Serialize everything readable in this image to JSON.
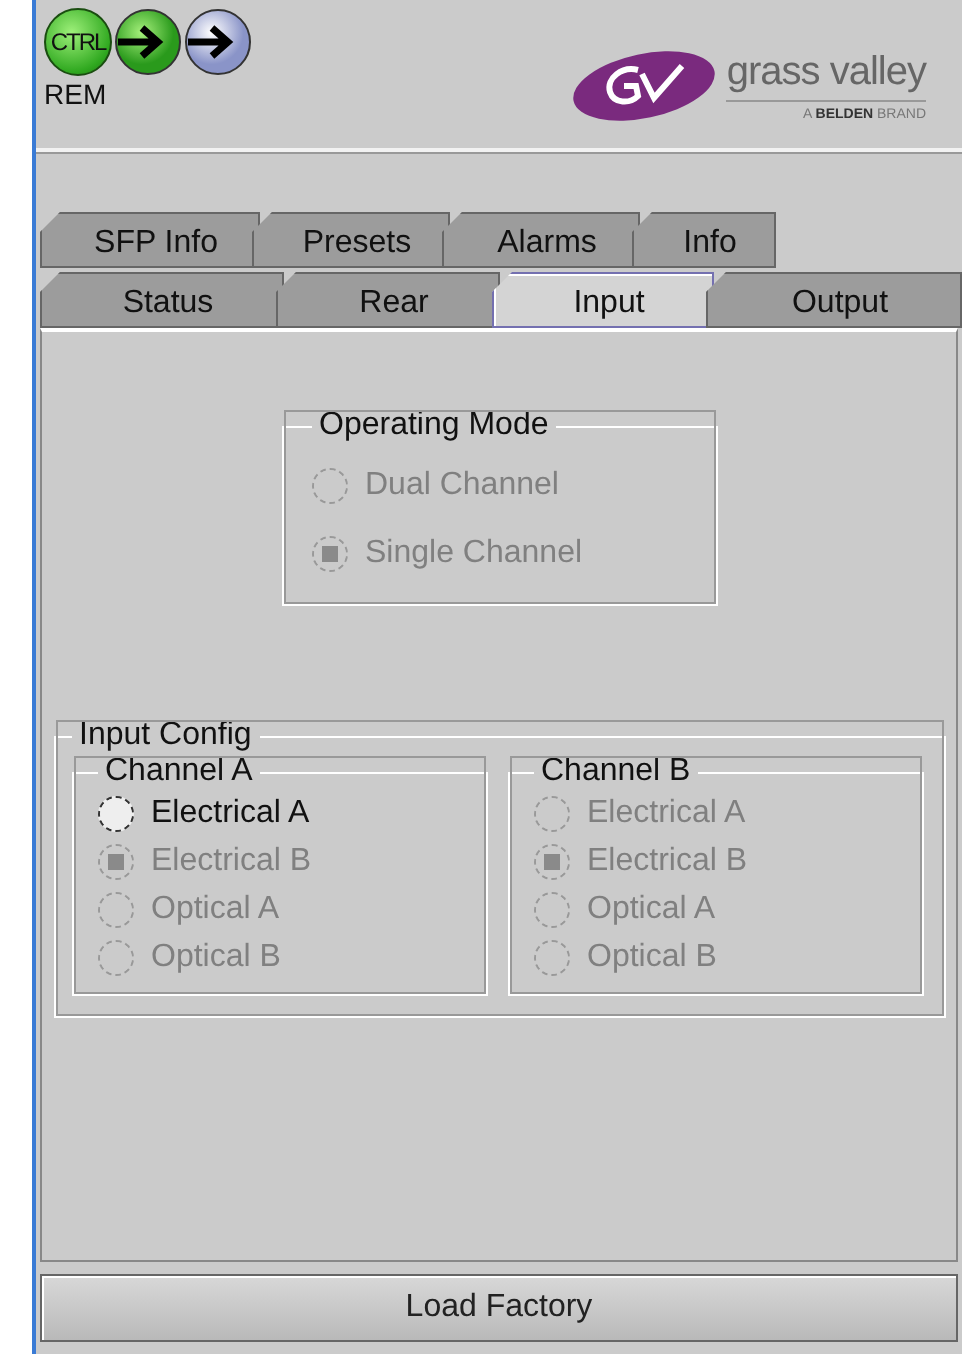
{
  "header": {
    "status": {
      "ctrl_label": "CTRL",
      "rem_label": "REM"
    },
    "logo": {
      "name": "grass valley",
      "tagline": "A **BELDEN** BRAND"
    }
  },
  "tab_rows": [
    [
      {
        "label": "SFP Info",
        "selected": false
      },
      {
        "label": "Presets",
        "selected": false
      },
      {
        "label": "Alarms",
        "selected": false
      },
      {
        "label": "Info",
        "selected": false
      }
    ],
    [
      {
        "label": "Status",
        "selected": false
      },
      {
        "label": "Rear",
        "selected": false
      },
      {
        "label": "Input",
        "selected": true
      },
      {
        "label": "Output",
        "selected": false
      }
    ]
  ],
  "operating_mode": {
    "title": "Operating Mode",
    "options": [
      {
        "label": "Dual Channel",
        "selected": false,
        "disabled": true
      },
      {
        "label": "Single Channel",
        "selected": true,
        "disabled": true
      }
    ]
  },
  "input_config": {
    "title": "Input Config",
    "channels": [
      {
        "title": "Channel A",
        "options": [
          {
            "label": "Electrical A",
            "selected": false,
            "disabled": false
          },
          {
            "label": "Electrical B",
            "selected": true,
            "disabled": true
          },
          {
            "label": "Optical A",
            "selected": false,
            "disabled": true
          },
          {
            "label": "Optical B",
            "selected": false,
            "disabled": true
          }
        ]
      },
      {
        "title": "Channel B",
        "options": [
          {
            "label": "Electrical A",
            "selected": false,
            "disabled": true
          },
          {
            "label": "Electrical B",
            "selected": true,
            "disabled": true
          },
          {
            "label": "Optical A",
            "selected": false,
            "disabled": true
          },
          {
            "label": "Optical B",
            "selected": false,
            "disabled": true
          }
        ]
      }
    ]
  },
  "button": {
    "label": "Load Factory"
  }
}
